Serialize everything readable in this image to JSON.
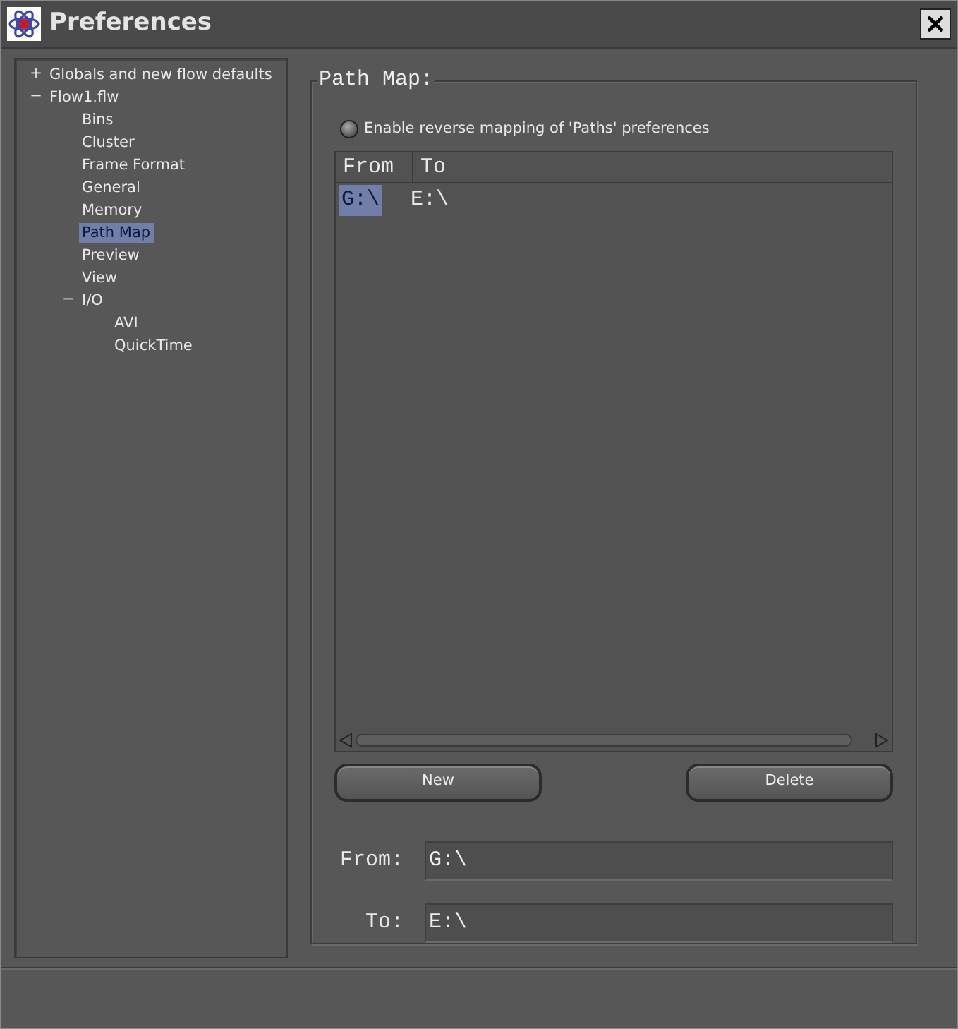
{
  "window": {
    "title": "Preferences"
  },
  "tree": [
    {
      "label": "Globals and new flow defaults",
      "toggle": "+",
      "selected": false
    },
    {
      "label": "Flow1.flw",
      "toggle": "−",
      "selected": false,
      "children": [
        {
          "label": "Bins",
          "selected": false
        },
        {
          "label": "Cluster",
          "selected": false
        },
        {
          "label": "Frame Format",
          "selected": false
        },
        {
          "label": "General",
          "selected": false
        },
        {
          "label": "Memory",
          "selected": false
        },
        {
          "label": "Path Map",
          "selected": true
        },
        {
          "label": "Preview",
          "selected": false
        },
        {
          "label": "View",
          "selected": false
        },
        {
          "label": "I/O",
          "toggle": "−",
          "selected": false,
          "children": [
            {
              "label": "AVI",
              "selected": false
            },
            {
              "label": "QuickTime",
              "selected": false
            }
          ]
        }
      ]
    }
  ],
  "path_map": {
    "title": "Path Map:",
    "reverse_mapping": {
      "label": "Enable reverse mapping of 'Paths' preferences",
      "checked": false
    },
    "table": {
      "columns": [
        "From",
        "To"
      ],
      "rows": [
        {
          "cells": [
            "G:\\",
            "E:\\"
          ],
          "selected": true
        }
      ]
    },
    "buttons": [
      "New",
      "Delete"
    ],
    "fields": [
      {
        "label": "From:",
        "value": "G:\\"
      },
      {
        "label": "To:",
        "value": "E:\\"
      }
    ]
  }
}
